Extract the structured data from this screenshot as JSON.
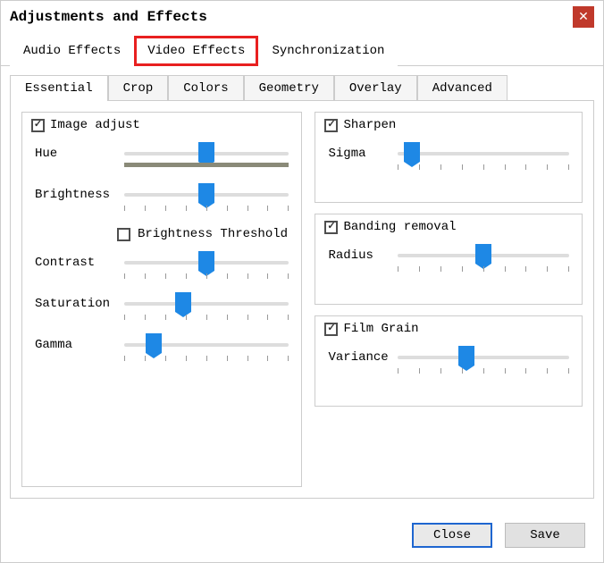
{
  "title": "Adjustments and Effects",
  "main_tabs": {
    "audio": "Audio Effects",
    "video": "Video Effects",
    "sync": "Synchronization"
  },
  "sub_tabs": {
    "essential": "Essential",
    "crop": "Crop",
    "colors": "Colors",
    "geometry": "Geometry",
    "overlay": "Overlay",
    "advanced": "Advanced"
  },
  "image_adjust": {
    "legend": "Image adjust",
    "checked": true,
    "hue": {
      "label": "Hue",
      "pos": 50
    },
    "brightness": {
      "label": "Brightness",
      "pos": 50
    },
    "brightness_threshold": {
      "label": "Brightness Threshold",
      "checked": false
    },
    "contrast": {
      "label": "Contrast",
      "pos": 50
    },
    "saturation": {
      "label": "Saturation",
      "pos": 36
    },
    "gamma": {
      "label": "Gamma",
      "pos": 18
    }
  },
  "sharpen": {
    "legend": "Sharpen",
    "checked": true,
    "sigma": {
      "label": "Sigma",
      "pos": 8
    }
  },
  "banding": {
    "legend": "Banding removal",
    "checked": true,
    "radius": {
      "label": "Radius",
      "pos": 50
    }
  },
  "film_grain": {
    "legend": "Film Grain",
    "checked": true,
    "variance": {
      "label": "Variance",
      "pos": 40
    }
  },
  "buttons": {
    "close": "Close",
    "save": "Save"
  }
}
